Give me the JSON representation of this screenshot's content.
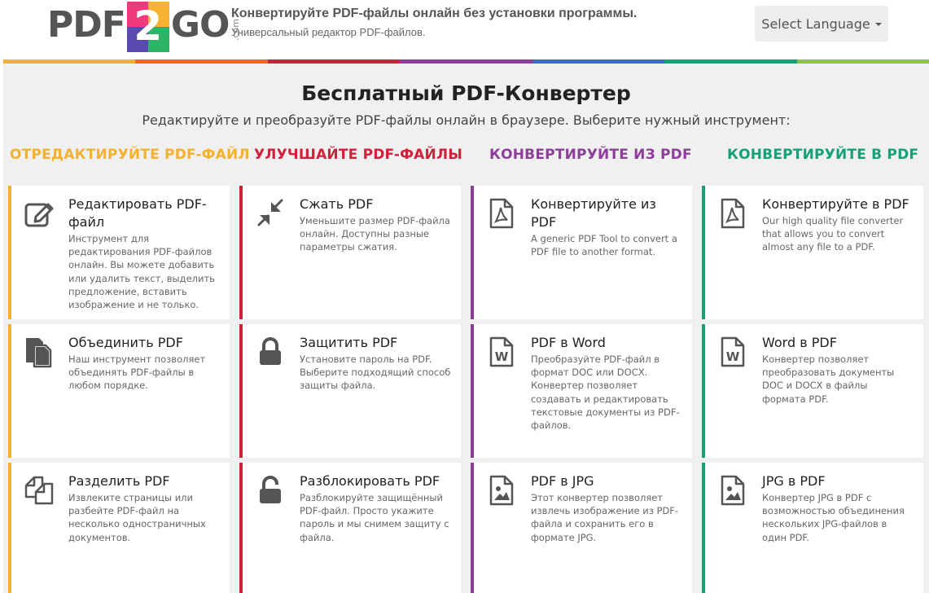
{
  "header": {
    "logo": {
      "pdf": "PDF",
      "two": "2",
      "go": "GO",
      "com": ".com"
    },
    "tagline_main": "Конвертируйте PDF-файлы онлайн без установки программы.",
    "tagline_sub": "Универсальный редактор PDF-файлов.",
    "language_button": "Select Language"
  },
  "colors": {
    "edit": "#f2b130",
    "improve": "#d0213c",
    "convert_from": "#8b3f97",
    "convert_to": "#17a077",
    "bar": [
      "#f2b130",
      "#e66a2c",
      "#d0213c",
      "#8b3f97",
      "#3a6fb5",
      "#17a077",
      "#8cc152"
    ]
  },
  "main": {
    "title": "Бесплатный PDF-Конвертер",
    "subtitle": "Редактируйте и преобразуйте PDF-файлы онлайн в браузере. Выберите нужный инструмент:"
  },
  "columns": [
    {
      "heading": "Отредактируйте PDF-файл",
      "cards": [
        {
          "title": "Редактировать PDF-файл",
          "icon": "edit-icon",
          "desc": "Инструмент для редактирования PDF-файлов онлайн. Вы можете добавить или удалить текст, выделить предложение, вставить изображение и не только."
        },
        {
          "title": "Объединить PDF",
          "icon": "merge-icon",
          "desc": "Наш инструмент позволяет объединять PDF-файлы в любом порядке."
        },
        {
          "title": "Разделить PDF",
          "icon": "split-icon",
          "desc": "Извлеките страницы или разбейте PDF-файл на несколько одностраничных документов."
        }
      ]
    },
    {
      "heading": "Улучшайте PDF-файлы",
      "cards": [
        {
          "title": "Сжать PDF",
          "icon": "compress-icon",
          "desc": "Уменьшите размер PDF-файла онлайн. Доступны разные параметры сжатия."
        },
        {
          "title": "Защитить PDF",
          "icon": "lock-icon",
          "desc": "Установите пароль на PDF. Выберите подходящий способ защиты файла."
        },
        {
          "title": "Разблокировать PDF",
          "icon": "unlock-icon",
          "desc": "Разблокируйте защищённый PDF-файл. Просто укажите пароль и мы снимем защиту с файла."
        }
      ]
    },
    {
      "heading": "Конвертируйте из PDF",
      "cards": [
        {
          "title": "Конвертируйте из PDF",
          "icon": "pdf-file-icon",
          "desc": "A generic PDF Tool to convert a PDF file to another format."
        },
        {
          "title": "PDF в Word",
          "icon": "word-file-icon",
          "desc": "Преобразуйте PDF-файл в формат DOC или DOCX. Конвертер позволяет создавать и редактировать текстовые документы из PDF-файлов."
        },
        {
          "title": "PDF в JPG",
          "icon": "image-file-icon",
          "desc": "Этот конвертер позволяет извлечь изображение из PDF-файла и сохранить его в формате JPG."
        }
      ]
    },
    {
      "heading": "Конвертируйте в PDF",
      "cards": [
        {
          "title": "Конвертируйте в PDF",
          "icon": "pdf-file-icon",
          "desc": "Our high quality file converter that allows you to convert almost any file to a PDF."
        },
        {
          "title": "Word в PDF",
          "icon": "word-file-icon",
          "desc": "Конвертер позволяет преобразовать документы DOC и DOCX в файлы формата PDF."
        },
        {
          "title": "JPG в PDF",
          "icon": "image-file-icon",
          "desc": "Конвертер JPG в PDF с возможностью объединения нескольких JPG-файлов в один PDF."
        }
      ]
    }
  ]
}
